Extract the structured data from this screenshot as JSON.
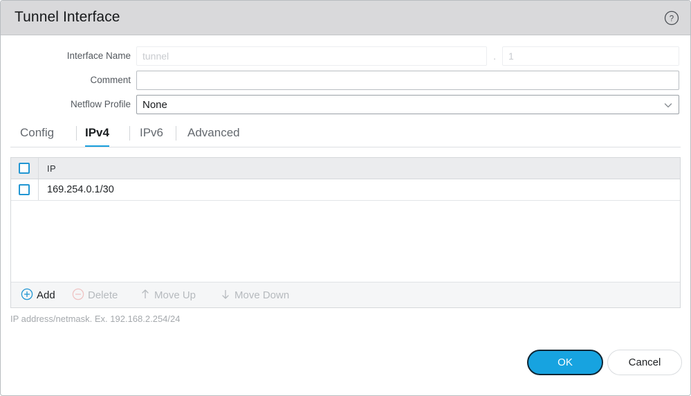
{
  "dialog": {
    "title": "Tunnel Interface",
    "help_icon": "question-circle-icon"
  },
  "form": {
    "interface_name": {
      "label": "Interface Name",
      "value": "",
      "placeholder": "tunnel",
      "separator": ".",
      "suffix_value": "",
      "suffix_placeholder": "1"
    },
    "comment": {
      "label": "Comment",
      "value": "",
      "placeholder": ""
    },
    "netflow_profile": {
      "label": "Netflow Profile",
      "value": "None",
      "chevron_icon": "chevron-down-icon"
    }
  },
  "tabs": [
    {
      "label": "Config",
      "active": false
    },
    {
      "label": "IPv4",
      "active": true
    },
    {
      "label": "IPv6",
      "active": false
    },
    {
      "label": "Advanced",
      "active": false
    }
  ],
  "table": {
    "select_all_checked": false,
    "columns": [
      "IP"
    ],
    "rows": [
      {
        "checked": false,
        "ip": "169.254.0.1/30"
      }
    ],
    "toolbar": [
      {
        "label": "Add",
        "icon": "plus-circle-icon",
        "enabled": true
      },
      {
        "label": "Delete",
        "icon": "minus-circle-icon",
        "enabled": false
      },
      {
        "label": "Move Up",
        "icon": "arrow-up-icon",
        "enabled": false
      },
      {
        "label": "Move Down",
        "icon": "arrow-down-icon",
        "enabled": false
      }
    ]
  },
  "helper_text": "IP address/netmask. Ex. 192.168.2.254/24",
  "footer": {
    "ok_label": "OK",
    "cancel_label": "Cancel"
  },
  "colors": {
    "accent_blue": "#17a3e0",
    "tab_underline": "#1aa0dd",
    "checkbox_border": "#2196d3",
    "titlebar_gray": "#d9d9db",
    "add_icon": "#2196d3",
    "delete_icon": "#efc3c3"
  }
}
